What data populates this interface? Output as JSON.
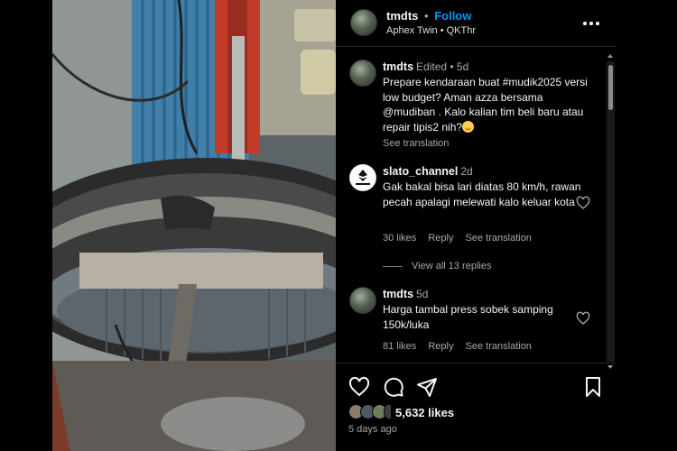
{
  "post": {
    "username": "tmdts",
    "follow_label": "Follow",
    "audio": "Aphex Twin • QKThr"
  },
  "comments": [
    {
      "username": "tmdts",
      "meta": "Edited • 5d",
      "text": "Prepare kendaraan buat #mudik2025 versi low budget? Aman azza bersama @mudiban . Kalo kalian tim beli baru atau repair tipis2 nih?",
      "see_translation": "See translation"
    },
    {
      "username": "slato_channel",
      "meta": "2d",
      "text": "Gak bakal bisa lari diatas 80 km/h, rawan pecah apalagi melewati kalo keluar kota",
      "likes": "30 likes",
      "reply": "Reply",
      "see_translation": "See translation",
      "view_replies": "View all 13 replies"
    },
    {
      "username": "tmdts",
      "meta": "5d",
      "text": "Harga tambal press sobek samping 150k/luka",
      "likes": "81 likes",
      "reply": "Reply",
      "see_translation": "See translation"
    }
  ],
  "footer": {
    "likes_count": "5,632 likes",
    "time_ago": "5 days ago"
  },
  "colors": {
    "accent": "#0095f6",
    "muted": "#a8a8a8",
    "background": "#000000"
  },
  "icons": [
    "more-icon",
    "heart-icon",
    "comment-icon",
    "share-icon",
    "bookmark-icon"
  ]
}
